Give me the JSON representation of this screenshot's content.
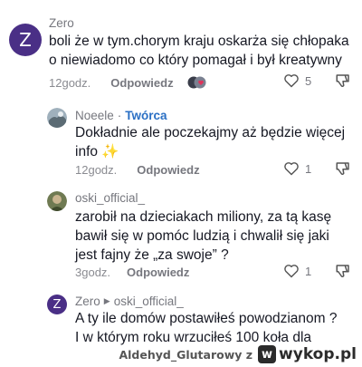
{
  "comments": [
    {
      "avatar_letter": "Z",
      "username": "Zero",
      "lines": [
        "boli że w tym.chorym kraju oskarża się chłopaka",
        "o niewiadomo co który pomagał i był kreatywny"
      ],
      "time": "12godz.",
      "reply_label": "Odpowiedz",
      "likes": "5"
    },
    {
      "username": "Noeele",
      "creator_label": "Twórca",
      "lines": [
        "Dokładnie ale poczekajmy aż będzie więcej",
        "info ✨"
      ],
      "time": "12godz.",
      "reply_label": "Odpowiedz",
      "likes": "1"
    },
    {
      "username": "oski_official_",
      "lines": [
        "zarobił na dzieciakach miliony, za tą kasę",
        "bawił się w pomóc ludzią i chwalił się jaki",
        "jest fajny że „za swoje” ?"
      ],
      "time": "3godz.",
      "reply_label": "Odpowiedz",
      "likes": "1"
    },
    {
      "avatar_letter": "Z",
      "username": "Zero",
      "reply_to": "oski_official_",
      "lines": [
        "A ty ile domów postawiłeś powodzianom ?",
        "I w którym roku wrzuciłeś 100 koła dla"
      ]
    }
  ],
  "footer": {
    "user": "Aldehyd_Glutarowy",
    "user_suffix": "z",
    "logo": "wykop.pl"
  },
  "colors": {
    "avatar_bg": "#4a2f86",
    "creator": "#2a6fc4",
    "heart_emoji_bg": "#e0335a"
  }
}
